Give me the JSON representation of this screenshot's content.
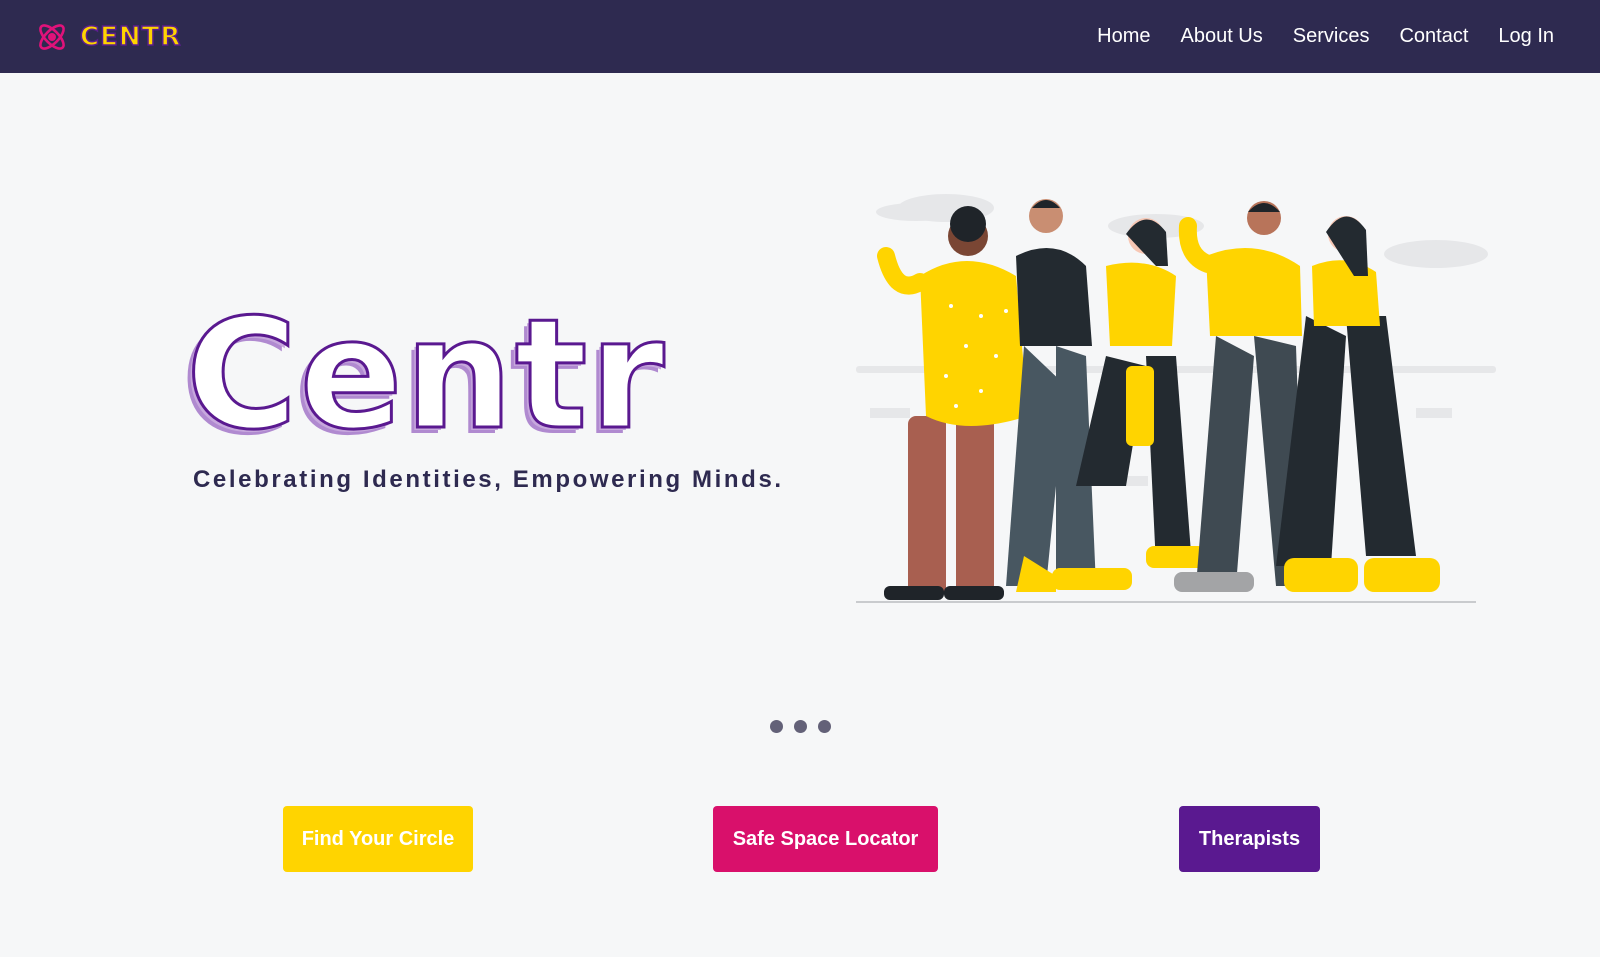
{
  "brand": {
    "logo_icon": "atom-icon",
    "name": "CENTR"
  },
  "nav": {
    "links": [
      "Home",
      "About Us",
      "Services",
      "Contact",
      "Log In"
    ]
  },
  "hero": {
    "title": "Centr",
    "tagline": "Celebrating Identities, Empowering Minds.",
    "illustration": "group-of-diverse-people-illustration"
  },
  "carousel": {
    "dot_count": 3
  },
  "cta": {
    "find_circle": "Find Your Circle",
    "safe_space": "Safe Space Locator",
    "therapists": "Therapists"
  },
  "colors": {
    "nav_bg": "#2e2a50",
    "yellow": "#ffd400",
    "pink": "#d9106b",
    "purple": "#5a1990",
    "page_bg": "#f6f7f8"
  }
}
